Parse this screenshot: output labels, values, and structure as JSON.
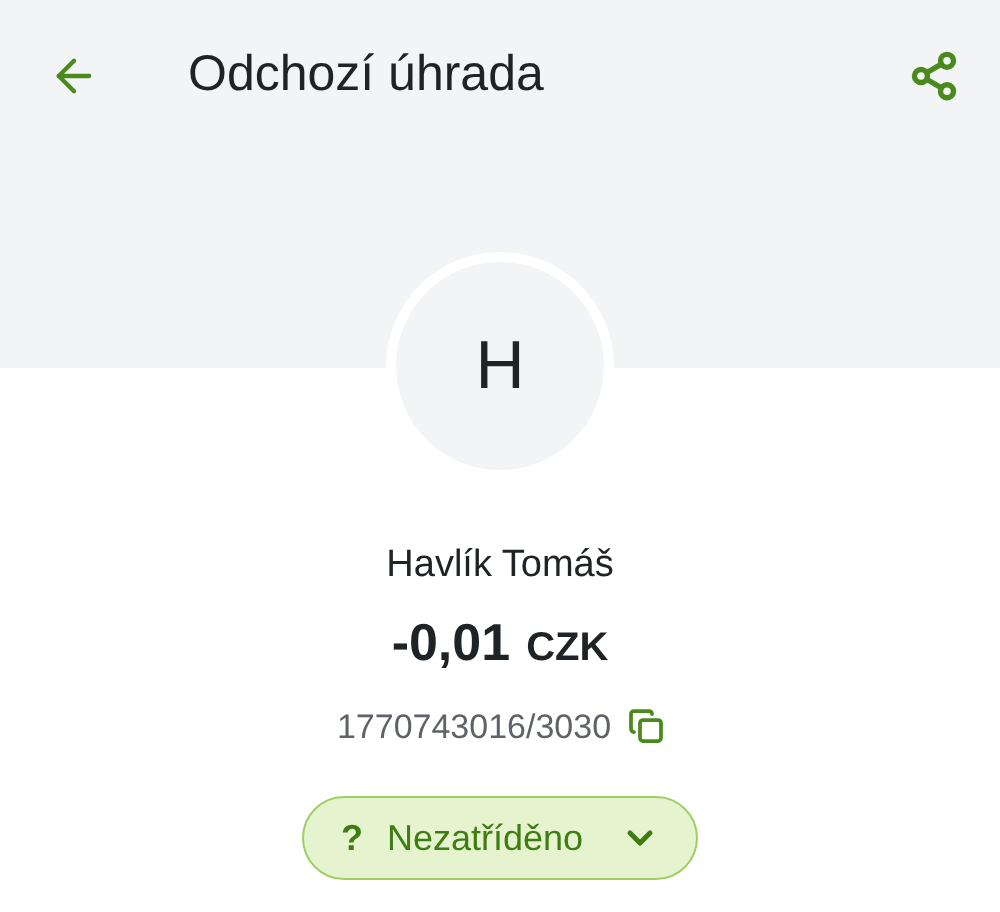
{
  "header": {
    "title": "Odchozí úhrada"
  },
  "counterparty": {
    "initial": "H",
    "name": "Havlík Tomáš",
    "amount": "-0,01",
    "currency": "CZK",
    "account": "1770743016/3030"
  },
  "category": {
    "icon": "?",
    "label": "Nezatříděno"
  }
}
